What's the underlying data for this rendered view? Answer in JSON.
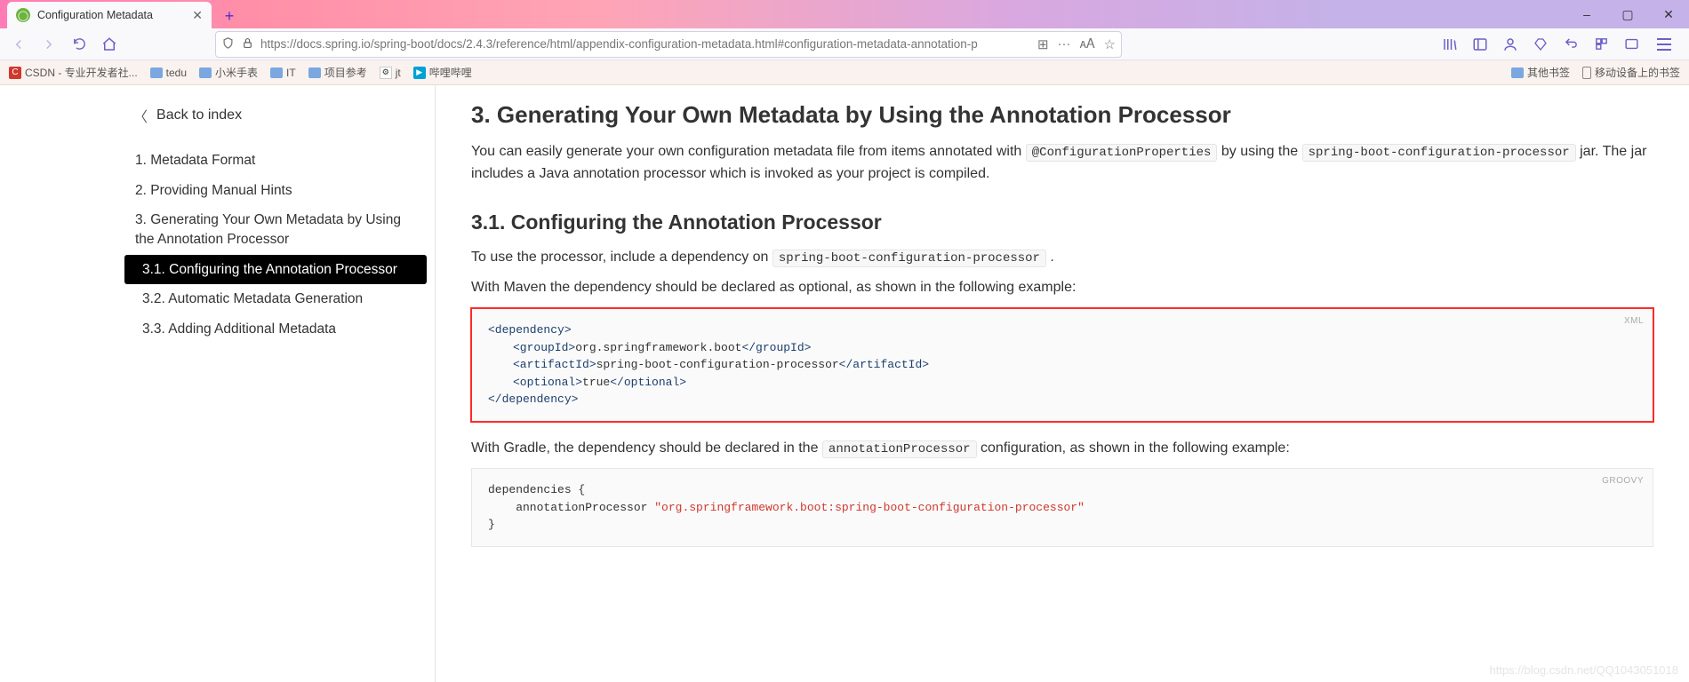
{
  "window": {
    "tab_title": "Configuration Metadata",
    "min_icon": "–",
    "max_icon": "▢",
    "close_icon": "✕",
    "newtab_icon": "+"
  },
  "nav": {
    "url": "https://docs.spring.io/spring-boot/docs/2.4.3/reference/html/appendix-configuration-metadata.html#configuration-metadata-annotation-p",
    "dots": "···",
    "star": "☆"
  },
  "bookmarks": {
    "items": [
      "CSDN - 专业开发者社...",
      "tedu",
      "小米手表",
      "IT",
      "项目参考",
      "jt",
      "哔哩哔哩"
    ],
    "other": "其他书签",
    "mobile": "移动设备上的书签"
  },
  "sidebar": {
    "back": "Back to index",
    "items": [
      "1. Metadata Format",
      "2. Providing Manual Hints",
      "3. Generating Your Own Metadata by Using the Annotation Processor",
      "3.1. Configuring the Annotation Processor",
      "3.2. Automatic Metadata Generation",
      "3.3. Adding Additional Metadata"
    ],
    "active_index": 3
  },
  "doc": {
    "h2": "3. Generating Your Own Metadata by Using the Annotation Processor",
    "p1_a": "You can easily generate your own configuration metadata file from items annotated with ",
    "p1_code": "@ConfigurationProperties",
    "p1_b": " by using the ",
    "p1_code2": "spring-boot-configuration-processor",
    "p1_c": " jar. The jar includes a Java annotation processor which is invoked as your project is compiled.",
    "h3": "3.1. Configuring the Annotation Processor",
    "p2_a": "To use the processor, include a dependency on ",
    "p2_code": "spring-boot-configuration-processor",
    "p2_b": " .",
    "p3": "With Maven the dependency should be declared as optional, as shown in the following example:",
    "xml_label": "XML",
    "xml": {
      "l1_open": "<dependency>",
      "l2_open": "<groupId>",
      "l2_val": "org.springframework.boot",
      "l2_close": "</groupId>",
      "l3_open": "<artifactId>",
      "l3_val": "spring-boot-configuration-processor",
      "l3_close": "</artifactId>",
      "l4_open": "<optional>",
      "l4_val": "true",
      "l4_close": "</optional>",
      "l5_close": "</dependency>"
    },
    "p4_a": "With Gradle, the dependency should be declared in the ",
    "p4_code": "annotationProcessor",
    "p4_b": " configuration, as shown in the following example:",
    "groovy_label": "GROOVY",
    "groovy": {
      "l1": "dependencies {",
      "l2_a": "    annotationProcessor ",
      "l2_str": "\"org.springframework.boot:spring-boot-configuration-processor\"",
      "l3": "}"
    }
  },
  "watermark": "https://blog.csdn.net/QQ1043051018"
}
